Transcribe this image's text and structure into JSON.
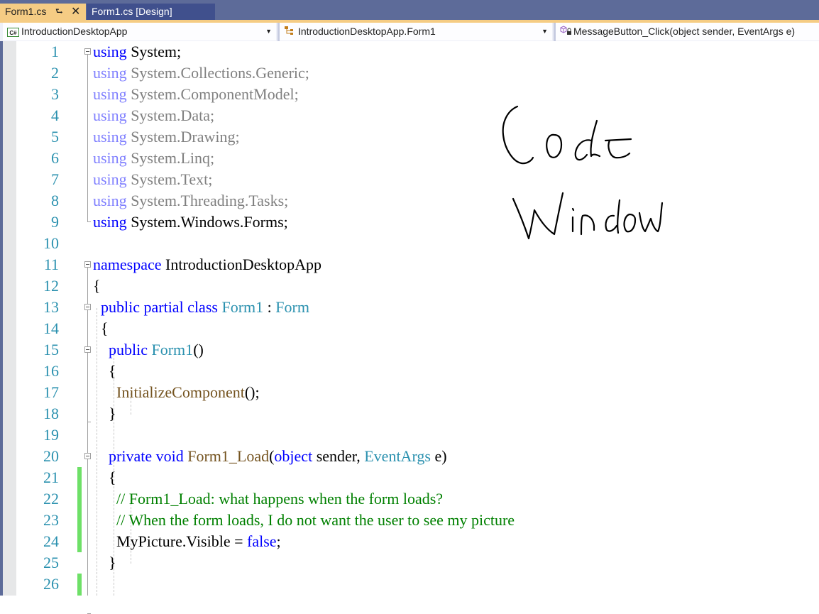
{
  "tabs": [
    {
      "label": "Form1.cs",
      "active": true,
      "pin_icon": "pin-icon",
      "close_icon": "close-icon"
    },
    {
      "label": "Form1.cs [Design]",
      "active": false
    }
  ],
  "navbar": {
    "project": {
      "label": "IntroductionDesktopApp",
      "icon": "csharp-project-icon"
    },
    "type": {
      "label": "IntroductionDesktopApp.Form1",
      "icon": "class-icon"
    },
    "member": {
      "label": "MessageButton_Click(object sender, EventArgs e)",
      "icon": "private-method-icon"
    }
  },
  "annotation": {
    "line1": "Code",
    "line2": "Window"
  },
  "colors": {
    "keyword": "#0000ff",
    "type": "#2b91af",
    "method": "#74531f",
    "comment": "#008000",
    "line_number": "#2b91af",
    "change_marker": "#6ee067",
    "active_tab": "#f5cc84",
    "tabstrip": "#5d6b99"
  },
  "lines": [
    {
      "n": "1",
      "tokens": [
        [
          "kw",
          "using"
        ],
        [
          "ns",
          " System;"
        ]
      ]
    },
    {
      "n": "2",
      "tokens": [
        [
          "kwd",
          "using"
        ],
        [
          "nsd",
          " System.Collections.Generic;"
        ]
      ]
    },
    {
      "n": "3",
      "tokens": [
        [
          "kwd",
          "using"
        ],
        [
          "nsd",
          " System.ComponentModel;"
        ]
      ]
    },
    {
      "n": "4",
      "tokens": [
        [
          "kwd",
          "using"
        ],
        [
          "nsd",
          " System.Data;"
        ]
      ]
    },
    {
      "n": "5",
      "tokens": [
        [
          "kwd",
          "using"
        ],
        [
          "nsd",
          " System.Drawing;"
        ]
      ]
    },
    {
      "n": "6",
      "tokens": [
        [
          "kwd",
          "using"
        ],
        [
          "nsd",
          " System.Linq;"
        ]
      ]
    },
    {
      "n": "7",
      "tokens": [
        [
          "kwd",
          "using"
        ],
        [
          "nsd",
          " System.Text;"
        ]
      ]
    },
    {
      "n": "8",
      "tokens": [
        [
          "kwd",
          "using"
        ],
        [
          "nsd",
          " System.Threading.Tasks;"
        ]
      ]
    },
    {
      "n": "9",
      "tokens": [
        [
          "kw",
          "using"
        ],
        [
          "ns",
          " System.Windows.Forms;"
        ]
      ]
    },
    {
      "n": "10",
      "tokens": []
    },
    {
      "n": "11",
      "tokens": [
        [
          "kw",
          "namespace"
        ],
        [
          "plain",
          " IntroductionDesktopApp"
        ]
      ]
    },
    {
      "n": "12",
      "tokens": [
        [
          "plain",
          "{"
        ]
      ]
    },
    {
      "n": "13",
      "tokens": [
        [
          "plain",
          "  "
        ],
        [
          "kw",
          "public partial class"
        ],
        [
          "plain",
          " "
        ],
        [
          "type",
          "Form1"
        ],
        [
          "plain",
          " : "
        ],
        [
          "type",
          "Form"
        ]
      ]
    },
    {
      "n": "14",
      "tokens": [
        [
          "plain",
          "  {"
        ]
      ]
    },
    {
      "n": "15",
      "tokens": [
        [
          "plain",
          "    "
        ],
        [
          "kw",
          "public"
        ],
        [
          "plain",
          " "
        ],
        [
          "type",
          "Form1"
        ],
        [
          "plain",
          "()"
        ]
      ]
    },
    {
      "n": "16",
      "tokens": [
        [
          "plain",
          "    {"
        ]
      ]
    },
    {
      "n": "17",
      "tokens": [
        [
          "plain",
          "      "
        ],
        [
          "meth",
          "InitializeComponent"
        ],
        [
          "plain",
          "();"
        ]
      ]
    },
    {
      "n": "18",
      "tokens": [
        [
          "plain",
          "    }"
        ]
      ]
    },
    {
      "n": "19",
      "tokens": []
    },
    {
      "n": "20",
      "tokens": [
        [
          "plain",
          "    "
        ],
        [
          "kw",
          "private void"
        ],
        [
          "plain",
          " "
        ],
        [
          "meth",
          "Form1_Load"
        ],
        [
          "plain",
          "("
        ],
        [
          "kw",
          "object"
        ],
        [
          "plain",
          " sender, "
        ],
        [
          "type",
          "EventArgs"
        ],
        [
          "plain",
          " e)"
        ]
      ]
    },
    {
      "n": "21",
      "tokens": [
        [
          "plain",
          "    {"
        ]
      ]
    },
    {
      "n": "22",
      "tokens": [
        [
          "plain",
          "      "
        ],
        [
          "cmt",
          "// Form1_Load: what happens when the form loads?"
        ]
      ]
    },
    {
      "n": "23",
      "tokens": [
        [
          "plain",
          "      "
        ],
        [
          "cmt",
          "// When the form loads, I do not want the user to see my picture"
        ]
      ]
    },
    {
      "n": "24",
      "tokens": [
        [
          "plain",
          "      MyPicture.Visible = "
        ],
        [
          "kw",
          "false"
        ],
        [
          "plain",
          ";"
        ]
      ]
    },
    {
      "n": "25",
      "tokens": [
        [
          "plain",
          "    }"
        ]
      ]
    },
    {
      "n": "26",
      "tokens": []
    }
  ]
}
